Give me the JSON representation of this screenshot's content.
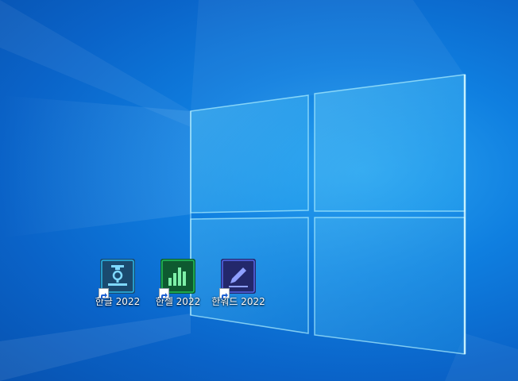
{
  "desktop": {
    "icons": [
      {
        "label": "한글 2022",
        "icon": "hangul-icon",
        "color": "#1f6f9e"
      },
      {
        "label": "한셀 2022",
        "icon": "hancell-icon",
        "color": "#14a24a"
      },
      {
        "label": "한워드 2022",
        "icon": "hanword-icon",
        "color": "#3a4fd0"
      }
    ]
  }
}
